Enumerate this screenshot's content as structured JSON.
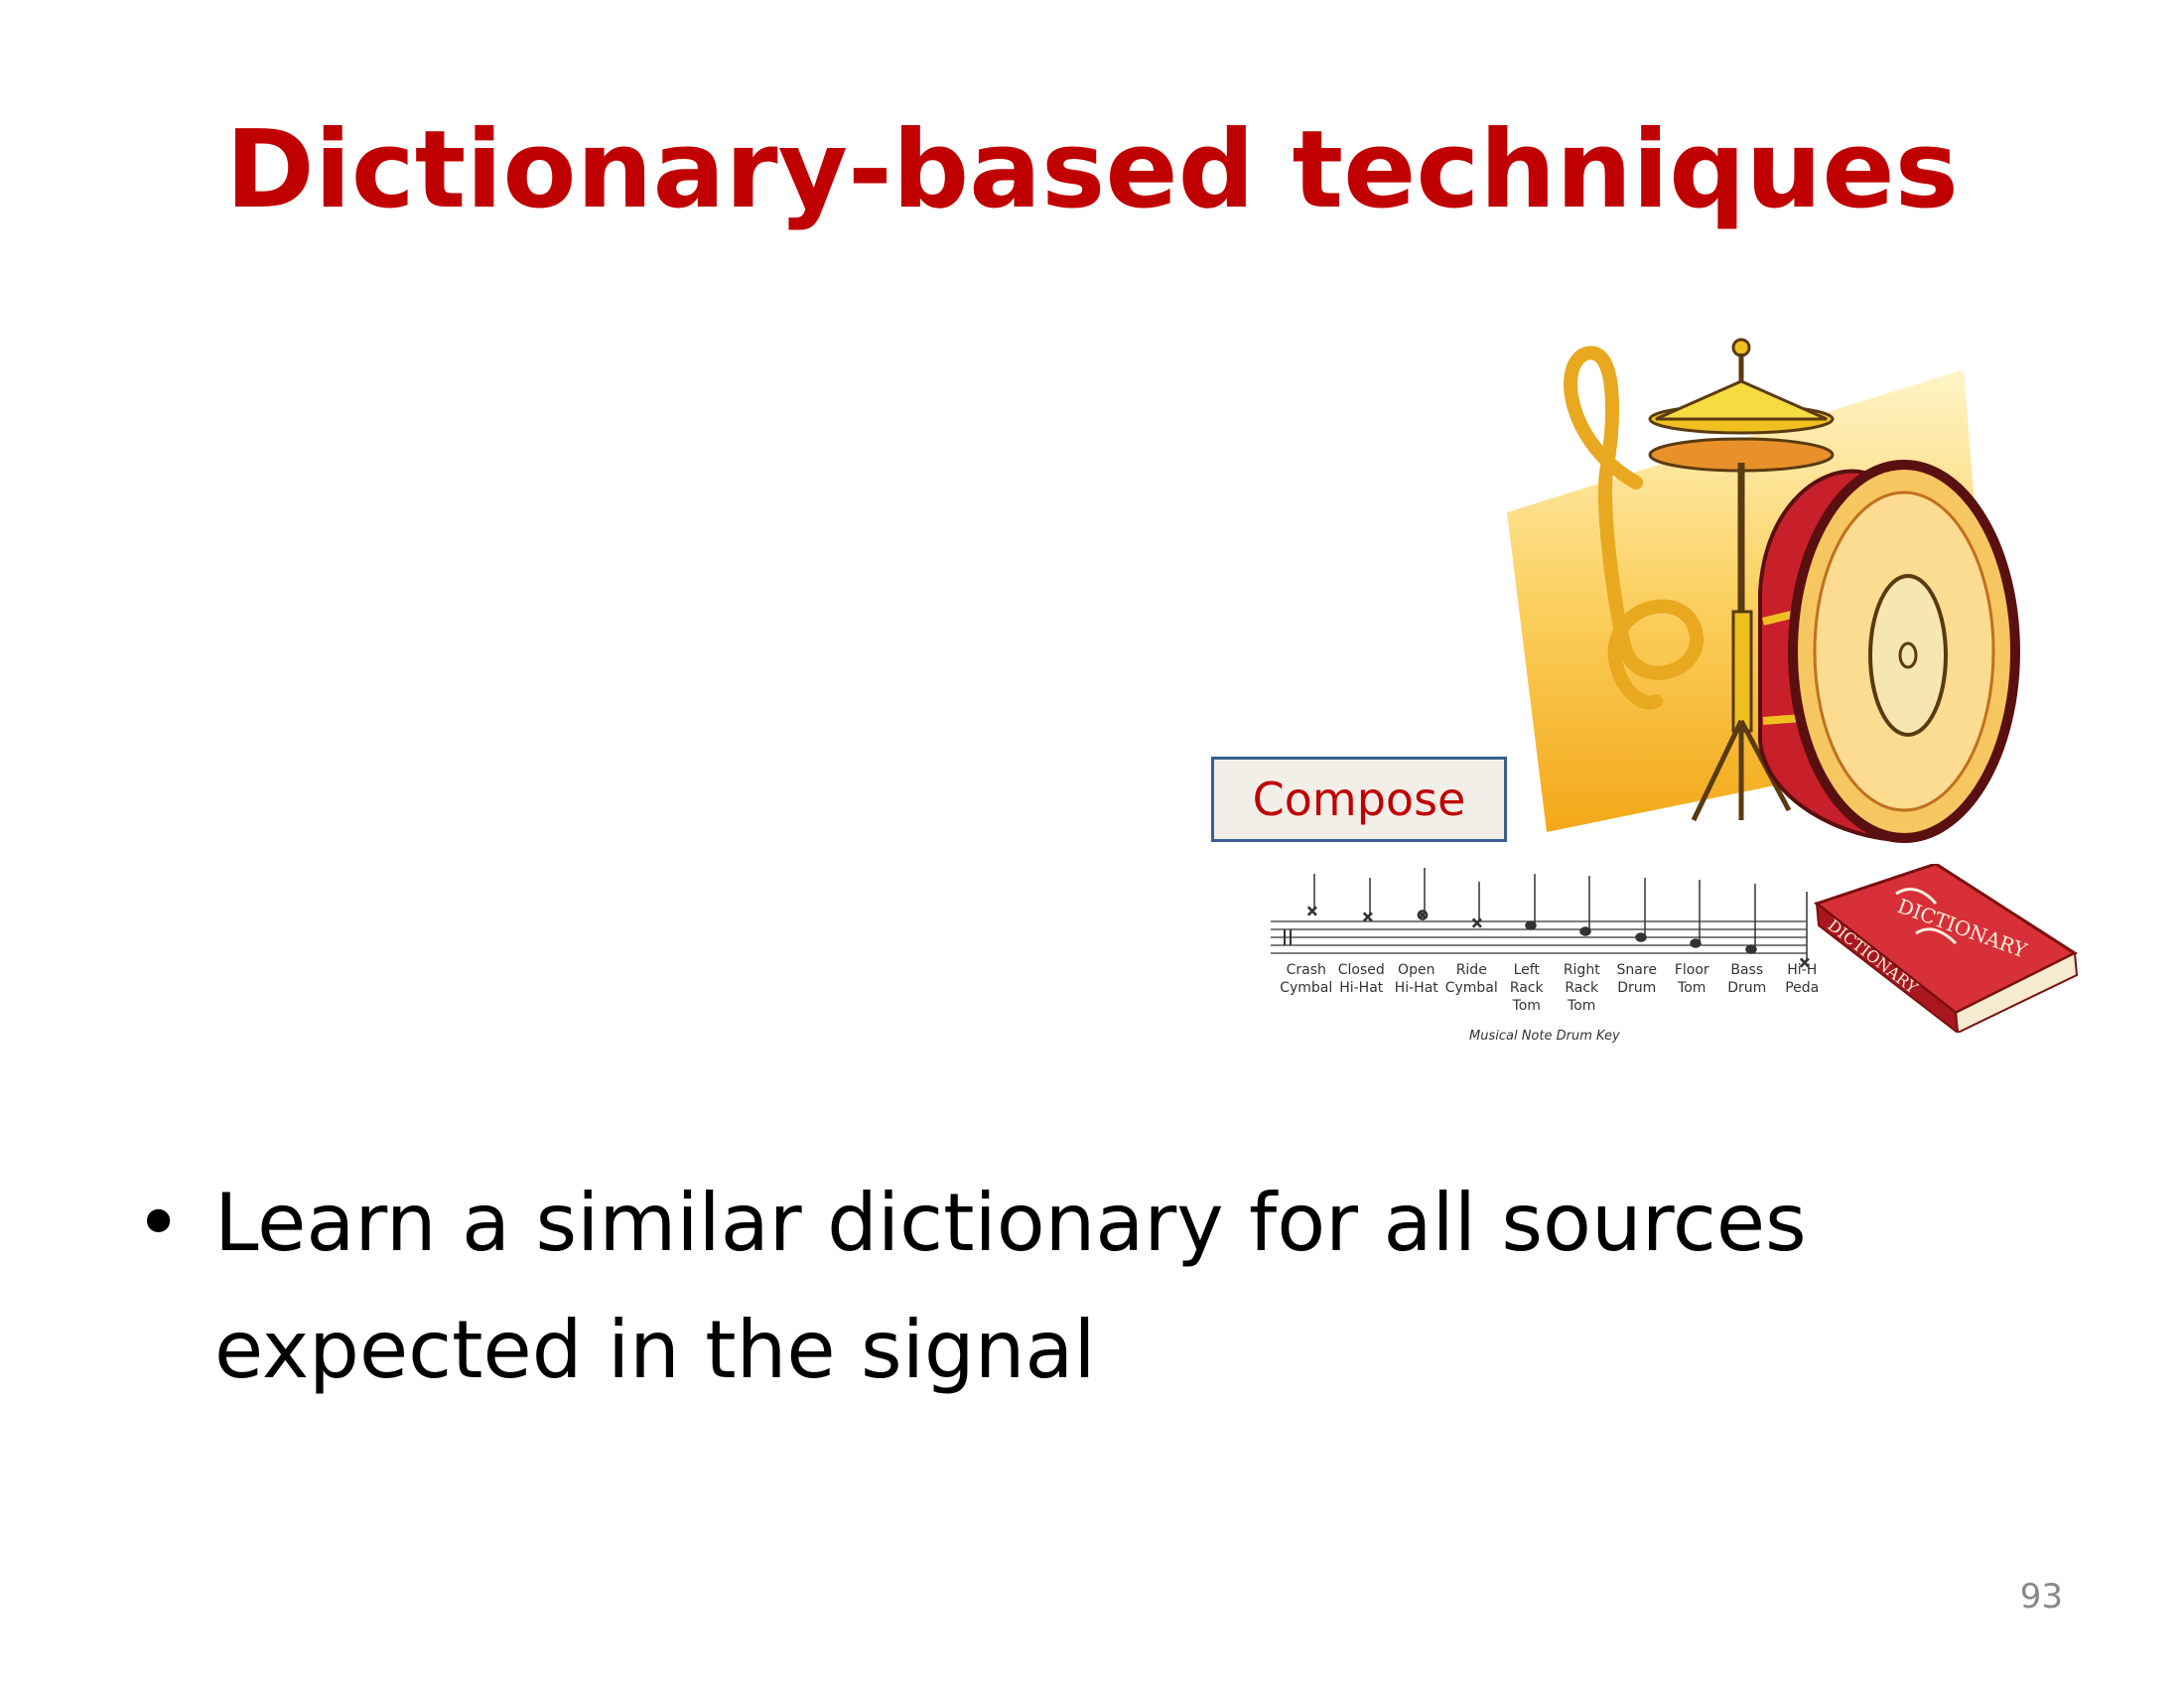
{
  "slide": {
    "title": "Dictionary-based techniques",
    "page_number": "93"
  },
  "compose_box": {
    "label": "Compose"
  },
  "drum_key": {
    "labels": [
      "Crash Cymbal",
      "Closed Hi-Hat",
      "Open Hi-Hat",
      "Ride Cymbal",
      "Left Rack Tom",
      "Right Rack Tom",
      "Snare Drum",
      "Floor Tom",
      "Bass Drum",
      "Hi-H Peda"
    ],
    "caption": "Musical Note Drum Key"
  },
  "dictionary_book": {
    "spine_text": "DICTIONARY",
    "cover_text": "DICTIONARY"
  },
  "bullets": [
    {
      "text": "Learn a similar dictionary for all sources expected in the signal"
    }
  ],
  "colors": {
    "title": "#c00000",
    "compose_border": "#3a5f8f",
    "book": "#c8202a"
  },
  "icons": [
    "drum-set-clipart",
    "treble-clef-icon",
    "dictionary-book-icon"
  ]
}
